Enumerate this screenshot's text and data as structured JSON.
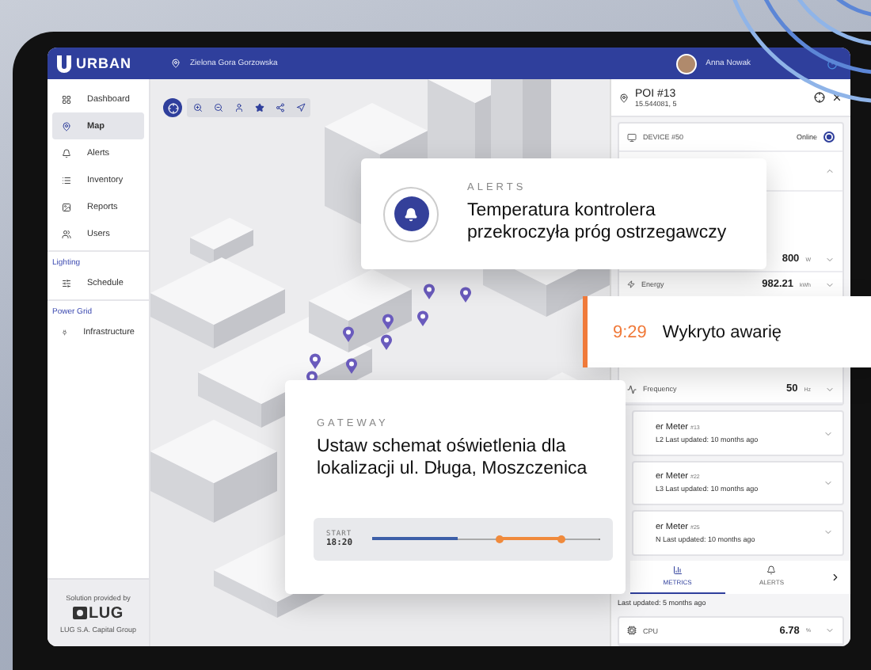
{
  "header": {
    "logo": "URBAN",
    "location": "Zielona Gora Gorzowska",
    "user": "Anna Nowak"
  },
  "sidebar": {
    "items": [
      {
        "label": "Dashboard",
        "selected": false
      },
      {
        "label": "Map",
        "selected": true
      },
      {
        "label": "Alerts",
        "selected": false
      },
      {
        "label": "Inventory",
        "selected": false
      },
      {
        "label": "Reports",
        "selected": false
      },
      {
        "label": "Users",
        "selected": false
      }
    ],
    "sections": [
      {
        "title": "Lighting",
        "items": [
          {
            "label": "Schedule",
            "selected": false
          }
        ]
      },
      {
        "title": "Power Grid",
        "items": [
          {
            "label": "Infrastructure",
            "selected": false
          }
        ]
      }
    ],
    "footer": {
      "caption": "Solution provided by",
      "logo": "LUG",
      "company": "LUG S.A. Capital Group"
    }
  },
  "panel": {
    "title": "POI #13",
    "coords": "15.544081, 5",
    "device": {
      "name": "DEVICE #50",
      "status": "Online"
    },
    "readings": [
      {
        "value": "800",
        "unit": "W"
      },
      {
        "label": "Energy",
        "value": "982.21",
        "unit": "kWh"
      }
    ],
    "frequency": {
      "label": "Frequency",
      "value": "50",
      "unit": "Hz"
    },
    "meters": [
      {
        "name": "er Meter",
        "id": "#13",
        "phase": "L2",
        "updated": "Last updated: 10 months ago"
      },
      {
        "name": "er Meter",
        "id": "#22",
        "phase": "L3",
        "updated": "Last updated: 10 months ago"
      },
      {
        "name": "er Meter",
        "id": "#25",
        "phase": "N",
        "updated": "Last updated: 10 months ago"
      }
    ],
    "tabs": [
      {
        "label": "METRICS",
        "selected": true
      },
      {
        "label": "ALERTS",
        "selected": false
      }
    ],
    "last_updated": "Last updated: 5 months ago",
    "cpu": {
      "label": "CPU",
      "value": "6.78",
      "unit": "%"
    }
  },
  "alert": {
    "category": "ALERTS",
    "message": "Temperatura kontrolera przekroczyła próg ostrzegawczy"
  },
  "event": {
    "time": "9:29",
    "message": "Wykryto awarię"
  },
  "gateway": {
    "category": "GATEWAY",
    "message": "Ustaw schemat oświetlenia dla lokalizacji ul. Długa, Moszczenica",
    "start_label": "START",
    "start_time": "18:20",
    "level": 0.38
  }
}
